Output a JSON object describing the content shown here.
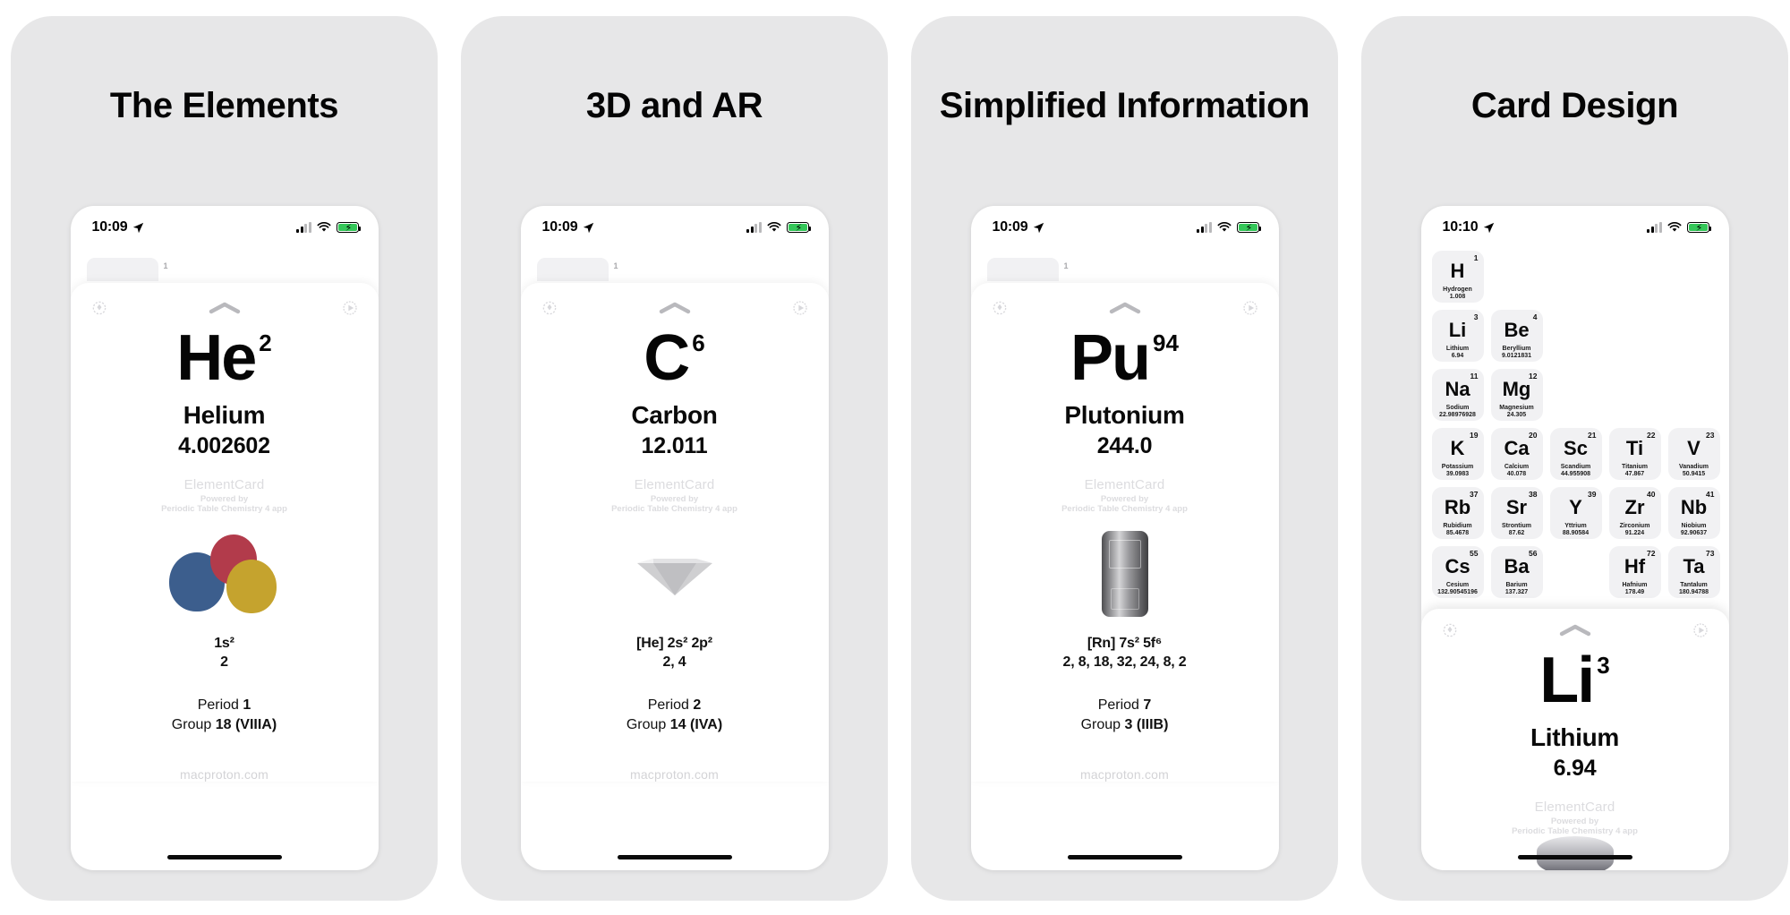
{
  "panels": [
    {
      "title": "The Elements",
      "status": {
        "time": "10:09",
        "battery_state": "charging"
      },
      "card": {
        "symbol": "He",
        "atomic_number": "2",
        "name": "Helium",
        "mass": "4.002602",
        "brand_title": "ElementCard",
        "brand_powered": "Powered by",
        "brand_app": "Periodic Table Chemistry 4 app",
        "config": "1s²",
        "shells": "2",
        "period_label": "Period",
        "period_value": "1",
        "group_label": "Group",
        "group_value": "18 (VIIIA)",
        "website": "macproton.com",
        "visual": "helium-balloons",
        "ghost_tab_number": "1"
      }
    },
    {
      "title": "3D and AR",
      "status": {
        "time": "10:09",
        "battery_state": "charging"
      },
      "card": {
        "symbol": "C",
        "atomic_number": "6",
        "name": "Carbon",
        "mass": "12.011",
        "brand_title": "ElementCard",
        "brand_powered": "Powered by",
        "brand_app": "Periodic Table Chemistry 4 app",
        "config": "[He] 2s² 2p²",
        "shells": "2, 4",
        "period_label": "Period",
        "period_value": "2",
        "group_label": "Group",
        "group_value": "14 (IVA)",
        "website": "macproton.com",
        "visual": "carbon-diamond",
        "ghost_tab_number": "1"
      }
    },
    {
      "title": "Simplified Information",
      "status": {
        "time": "10:09",
        "battery_state": "charging"
      },
      "card": {
        "symbol": "Pu",
        "atomic_number": "94",
        "name": "Plutonium",
        "mass": "244.0",
        "brand_title": "ElementCard",
        "brand_powered": "Powered by",
        "brand_app": "Periodic Table Chemistry 4 app",
        "config": "[Rn] 7s² 5f⁶",
        "shells": "2, 8, 18, 32, 24, 8, 2",
        "period_label": "Period",
        "period_value": "7",
        "group_label": "Group",
        "group_value": "3 (IIIB)",
        "website": "macproton.com",
        "visual": "plutonium-canister",
        "ghost_tab_number": "1"
      }
    },
    {
      "title": "Card Design",
      "status": {
        "time": "10:10",
        "battery_state": "charging"
      },
      "card": {
        "symbol": "Li",
        "atomic_number": "3",
        "name": "Lithium",
        "mass": "6.94",
        "brand_title": "ElementCard",
        "brand_powered": "Powered by",
        "brand_app": "Periodic Table Chemistry 4 app",
        "visual": "lithium-metal"
      }
    }
  ],
  "periodic_table": {
    "rows": [
      [
        {
          "z": "1",
          "symbol": "H",
          "name": "Hydrogen",
          "mass": "1.008"
        },
        {
          "empty": true
        },
        {
          "empty": true
        },
        {
          "empty": true
        },
        {
          "empty": true
        }
      ],
      [
        {
          "z": "3",
          "symbol": "Li",
          "name": "Lithium",
          "mass": "6.94"
        },
        {
          "z": "4",
          "symbol": "Be",
          "name": "Beryllium",
          "mass": "9.0121831"
        },
        {
          "empty": true
        },
        {
          "empty": true
        },
        {
          "empty": true
        }
      ],
      [
        {
          "z": "11",
          "symbol": "Na",
          "name": "Sodium",
          "mass": "22.98976928"
        },
        {
          "z": "12",
          "symbol": "Mg",
          "name": "Magnesium",
          "mass": "24.305"
        },
        {
          "empty": true
        },
        {
          "empty": true
        },
        {
          "empty": true
        }
      ],
      [
        {
          "z": "19",
          "symbol": "K",
          "name": "Potassium",
          "mass": "39.0983"
        },
        {
          "z": "20",
          "symbol": "Ca",
          "name": "Calcium",
          "mass": "40.078"
        },
        {
          "z": "21",
          "symbol": "Sc",
          "name": "Scandium",
          "mass": "44.955908"
        },
        {
          "z": "22",
          "symbol": "Ti",
          "name": "Titanium",
          "mass": "47.867"
        },
        {
          "z": "23",
          "symbol": "V",
          "name": "Vanadium",
          "mass": "50.9415"
        }
      ],
      [
        {
          "z": "37",
          "symbol": "Rb",
          "name": "Rubidium",
          "mass": "85.4678"
        },
        {
          "z": "38",
          "symbol": "Sr",
          "name": "Strontium",
          "mass": "87.62"
        },
        {
          "z": "39",
          "symbol": "Y",
          "name": "Yttrium",
          "mass": "88.90584"
        },
        {
          "z": "40",
          "symbol": "Zr",
          "name": "Zirconium",
          "mass": "91.224"
        },
        {
          "z": "41",
          "symbol": "Nb",
          "name": "Niobium",
          "mass": "92.90637"
        }
      ],
      [
        {
          "z": "55",
          "symbol": "Cs",
          "name": "Cesium",
          "mass": "132.90545196"
        },
        {
          "z": "56",
          "symbol": "Ba",
          "name": "Barium",
          "mass": "137.327"
        },
        {
          "empty": true
        },
        {
          "z": "72",
          "symbol": "Hf",
          "name": "Hafnium",
          "mass": "178.49"
        },
        {
          "z": "73",
          "symbol": "Ta",
          "name": "Tantalum",
          "mass": "180.94788"
        }
      ]
    ]
  },
  "icons": {
    "rotate": "rotate-3d-icon",
    "collapse": "chevron-up-icon",
    "ar": "ar-play-icon",
    "location": "location-arrow-icon",
    "wifi": "wifi-icon",
    "cellular": "cellular-signal-icon",
    "battery": "battery-charging-icon"
  },
  "colors": {
    "panel_bg": "#e7e7e8",
    "phone_bg": "#ffffff",
    "text": "#0a0a0a",
    "muted": "#dcdcdf",
    "cell_bg": "#f1f1f3",
    "battery_green": "#34c759"
  }
}
